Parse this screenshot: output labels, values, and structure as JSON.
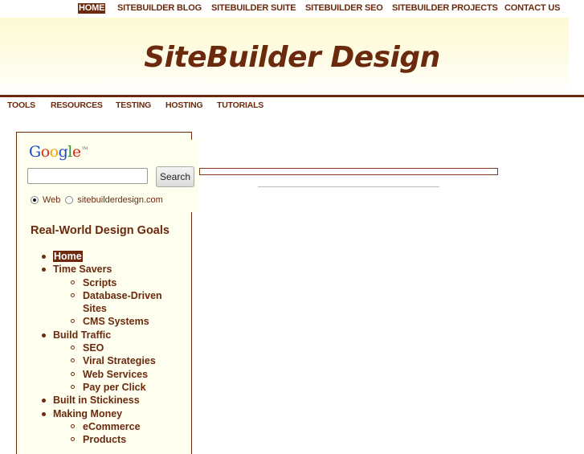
{
  "top_nav": {
    "items": [
      {
        "label": "HOME",
        "active": true
      },
      {
        "label": "SITEBUILDER BLOG",
        "active": false
      },
      {
        "label": "SITEBUILDER SUITE",
        "active": false
      },
      {
        "label": "SITEBUILDER SEO",
        "active": false
      },
      {
        "label": "SITEBUILDER PROJECTS",
        "active": false
      },
      {
        "label": "CONTACT US",
        "active": false
      }
    ]
  },
  "banner": {
    "title": "SiteBuilder Design"
  },
  "sub_nav": {
    "items": [
      {
        "label": "TOOLS"
      },
      {
        "label": "RESOURCES"
      },
      {
        "label": "TESTING"
      },
      {
        "label": "HOSTING"
      },
      {
        "label": "TUTORIALS"
      }
    ]
  },
  "google_search": {
    "logo_text": "Google",
    "trademark": "TM",
    "input_value": "",
    "button_label": "Search",
    "options": [
      {
        "label": "Web",
        "checked": true
      },
      {
        "label": "sitebuilderdesign.com",
        "checked": false
      }
    ]
  },
  "sidebar": {
    "title": "Real-World Design Goals",
    "menu": [
      {
        "label": "Home",
        "level": 1,
        "active": true
      },
      {
        "label": "Time Savers",
        "level": 1
      },
      {
        "label": "Scripts",
        "level": 2
      },
      {
        "label": "Database-Driven Sites",
        "level": 2
      },
      {
        "label": "CMS Systems",
        "level": 2
      },
      {
        "label": "Build Traffic",
        "level": 1
      },
      {
        "label": "SEO",
        "level": 2
      },
      {
        "label": "Viral Strategies",
        "level": 2
      },
      {
        "label": "Web Services",
        "level": 2
      },
      {
        "label": "Pay per Click",
        "level": 2
      },
      {
        "label": "Built in Stickiness",
        "level": 1
      },
      {
        "label": "Making Money",
        "level": 1
      },
      {
        "label": "eCommerce",
        "level": 2
      },
      {
        "label": "Products",
        "level": 2
      }
    ]
  },
  "colors": {
    "brand": "#6b2a0e",
    "panel_bg": "#fffff0",
    "banner_top": "#fdfbd4"
  }
}
